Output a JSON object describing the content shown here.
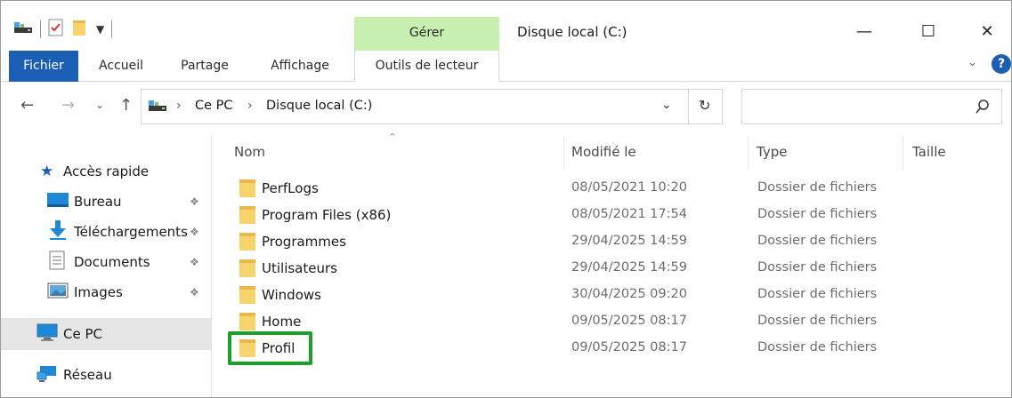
{
  "window": {
    "title": "Disque local (C:)",
    "context_group_label": "Gérer",
    "controls": {
      "minimize": "—",
      "maximize": "☐",
      "close": "✕"
    }
  },
  "quick_access_toolbar": {
    "icons": [
      "drive-icon",
      "properties-icon",
      "new-folder-icon",
      "customize-dropdown-icon"
    ]
  },
  "ribbon": {
    "tabs": [
      {
        "label": "Fichier",
        "active": true
      },
      {
        "label": "Accueil"
      },
      {
        "label": "Partage"
      },
      {
        "label": "Affichage"
      },
      {
        "label": "Outils de lecteur",
        "contextual": true
      }
    ],
    "help_label": "?"
  },
  "navigation": {
    "breadcrumb": [
      "Ce PC",
      "Disque local (C:)"
    ],
    "search_placeholder": ""
  },
  "nav_pane": {
    "items": [
      {
        "label": "Accès rapide",
        "icon": "star-icon"
      },
      {
        "label": "Bureau",
        "icon": "desktop-icon",
        "pinned": true
      },
      {
        "label": "Téléchargements",
        "icon": "download-icon",
        "pinned": true
      },
      {
        "label": "Documents",
        "icon": "documents-icon",
        "pinned": true
      },
      {
        "label": "Images",
        "icon": "images-icon",
        "pinned": true
      },
      {
        "label": "Ce PC",
        "icon": "computer-icon",
        "selected": true
      },
      {
        "label": "Réseau",
        "icon": "network-icon"
      }
    ]
  },
  "file_list": {
    "columns": [
      "Nom",
      "Modifié le",
      "Type",
      "Taille"
    ],
    "sort_column": "Nom",
    "rows": [
      {
        "name": "PerfLogs",
        "modified": "08/05/2021 10:20",
        "type": "Dossier de fichiers"
      },
      {
        "name": "Program Files (x86)",
        "modified": "08/05/2021 17:54",
        "type": "Dossier de fichiers"
      },
      {
        "name": "Programmes",
        "modified": "29/04/2025 14:59",
        "type": "Dossier de fichiers"
      },
      {
        "name": "Utilisateurs",
        "modified": "29/04/2025 14:59",
        "type": "Dossier de fichiers"
      },
      {
        "name": "Windows",
        "modified": "30/04/2025 09:20",
        "type": "Dossier de fichiers"
      },
      {
        "name": "Home",
        "modified": "09/05/2025 08:17",
        "type": "Dossier de fichiers"
      },
      {
        "name": "Profil",
        "modified": "09/05/2025 08:17",
        "type": "Dossier de fichiers",
        "highlighted": true
      }
    ]
  },
  "colors": {
    "accent": "#1a5fb4",
    "context_group": "#c6efb0",
    "highlight": "#1ba02c",
    "folder": "#f6d36b",
    "selection": "#e6e6e6"
  }
}
